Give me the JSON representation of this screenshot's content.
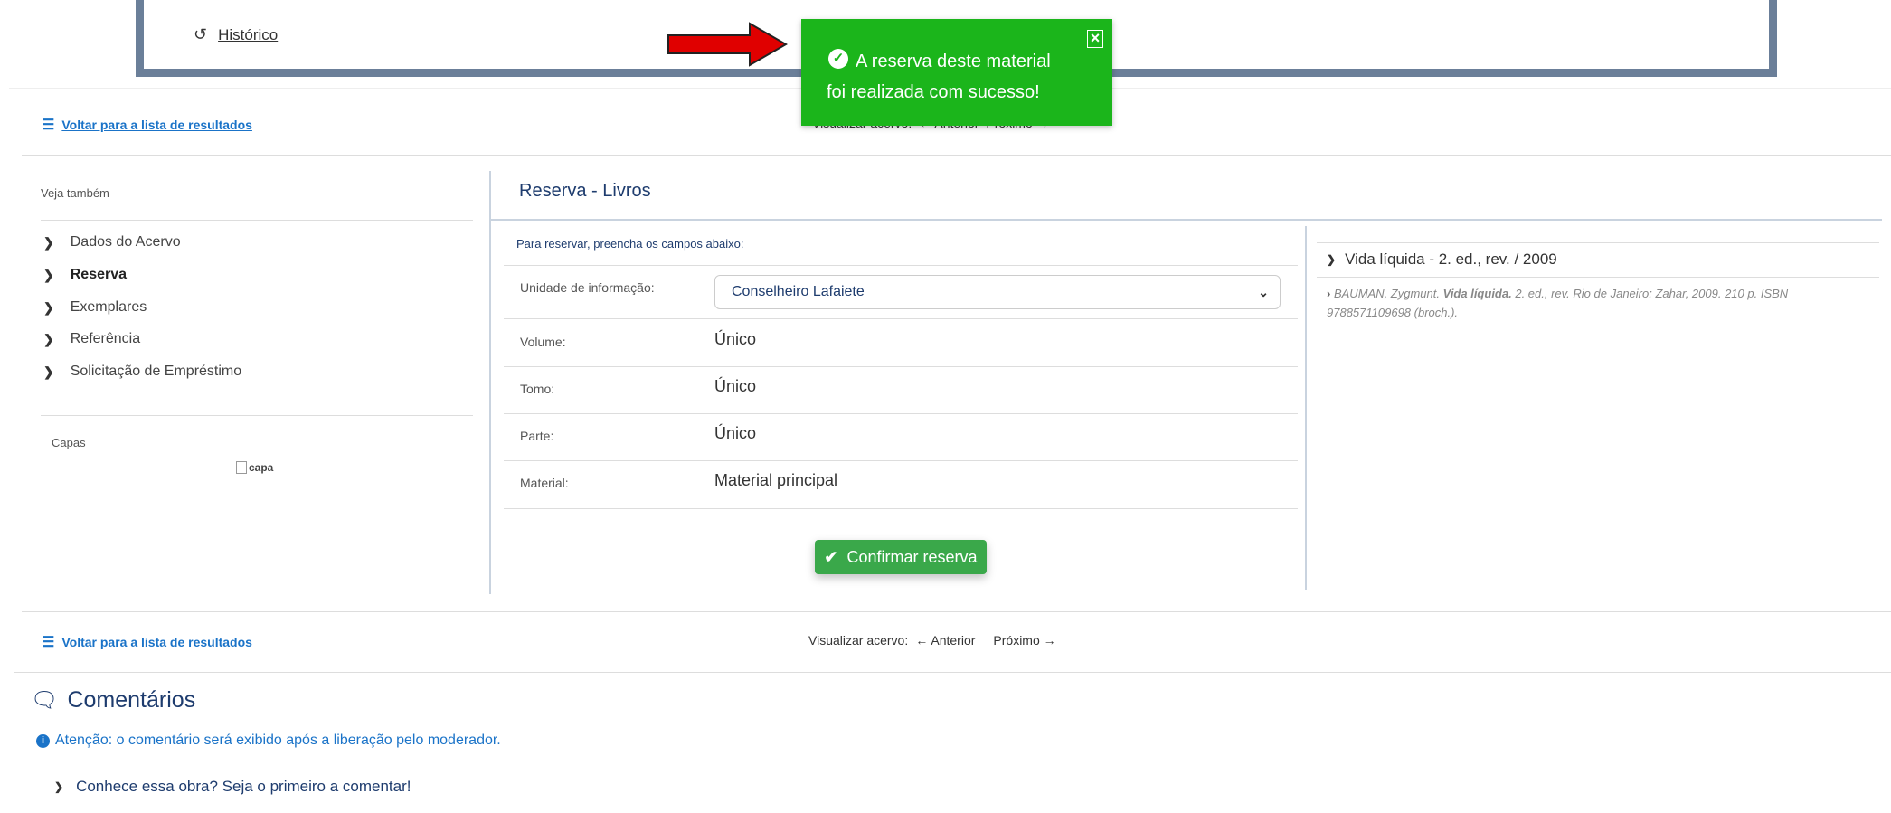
{
  "header": {
    "historico": "Histórico"
  },
  "toast": {
    "message_line1": "A reserva deste material",
    "message_line2": "foi realizada com sucesso!",
    "close": "×"
  },
  "nav_top": {
    "back_link": "Voltar para a lista de resultados",
    "view_label": "Visualizar acervo:",
    "prev": "Anterior",
    "next": "Próximo"
  },
  "sidebar": {
    "title": "Veja também",
    "items": [
      {
        "label": "Dados do Acervo"
      },
      {
        "label": "Reserva"
      },
      {
        "label": "Exemplares"
      },
      {
        "label": "Referência"
      },
      {
        "label": "Solicitação de Empréstimo"
      }
    ],
    "covers_title": "Capas",
    "cover_alt": "capa"
  },
  "reserva": {
    "title": "Reserva - Livros",
    "instructions": "Para reservar, preencha os campos abaixo:",
    "fields": [
      {
        "label": "Unidade de informação:",
        "value": "Conselheiro Lafaiete"
      },
      {
        "label": "Volume:",
        "value": "Único"
      },
      {
        "label": "Tomo:",
        "value": "Único"
      },
      {
        "label": "Parte:",
        "value": "Único"
      },
      {
        "label": "Material:",
        "value": "Material principal"
      }
    ],
    "confirm": "Confirmar reserva"
  },
  "record": {
    "title": "Vida líquida - 2. ed., rev. / 2009",
    "ref_author": "BAUMAN, Zygmunt.",
    "ref_title": "Vida líquida.",
    "ref_rest": "2. ed., rev. Rio de Janeiro: Zahar, 2009. 210 p. ISBN",
    "ref_isbn": "9788571109698 (broch.)."
  },
  "nav_bottom": {
    "back_link": "Voltar para a lista de resultados",
    "view_label": "Visualizar acervo:",
    "prev": "Anterior",
    "next": "Próximo"
  },
  "comments": {
    "title": "Comentários",
    "notice": "Atenção: o comentário será exibido após a liberação pelo moderador.",
    "first": "Conhece essa obra? Seja o primeiro a comentar!"
  },
  "colors": {
    "toast_bg": "#1bb51b",
    "frame": "#6b7f99",
    "link": "#1a73c8",
    "button": "#3aa84a",
    "arrow": "#e00000"
  }
}
